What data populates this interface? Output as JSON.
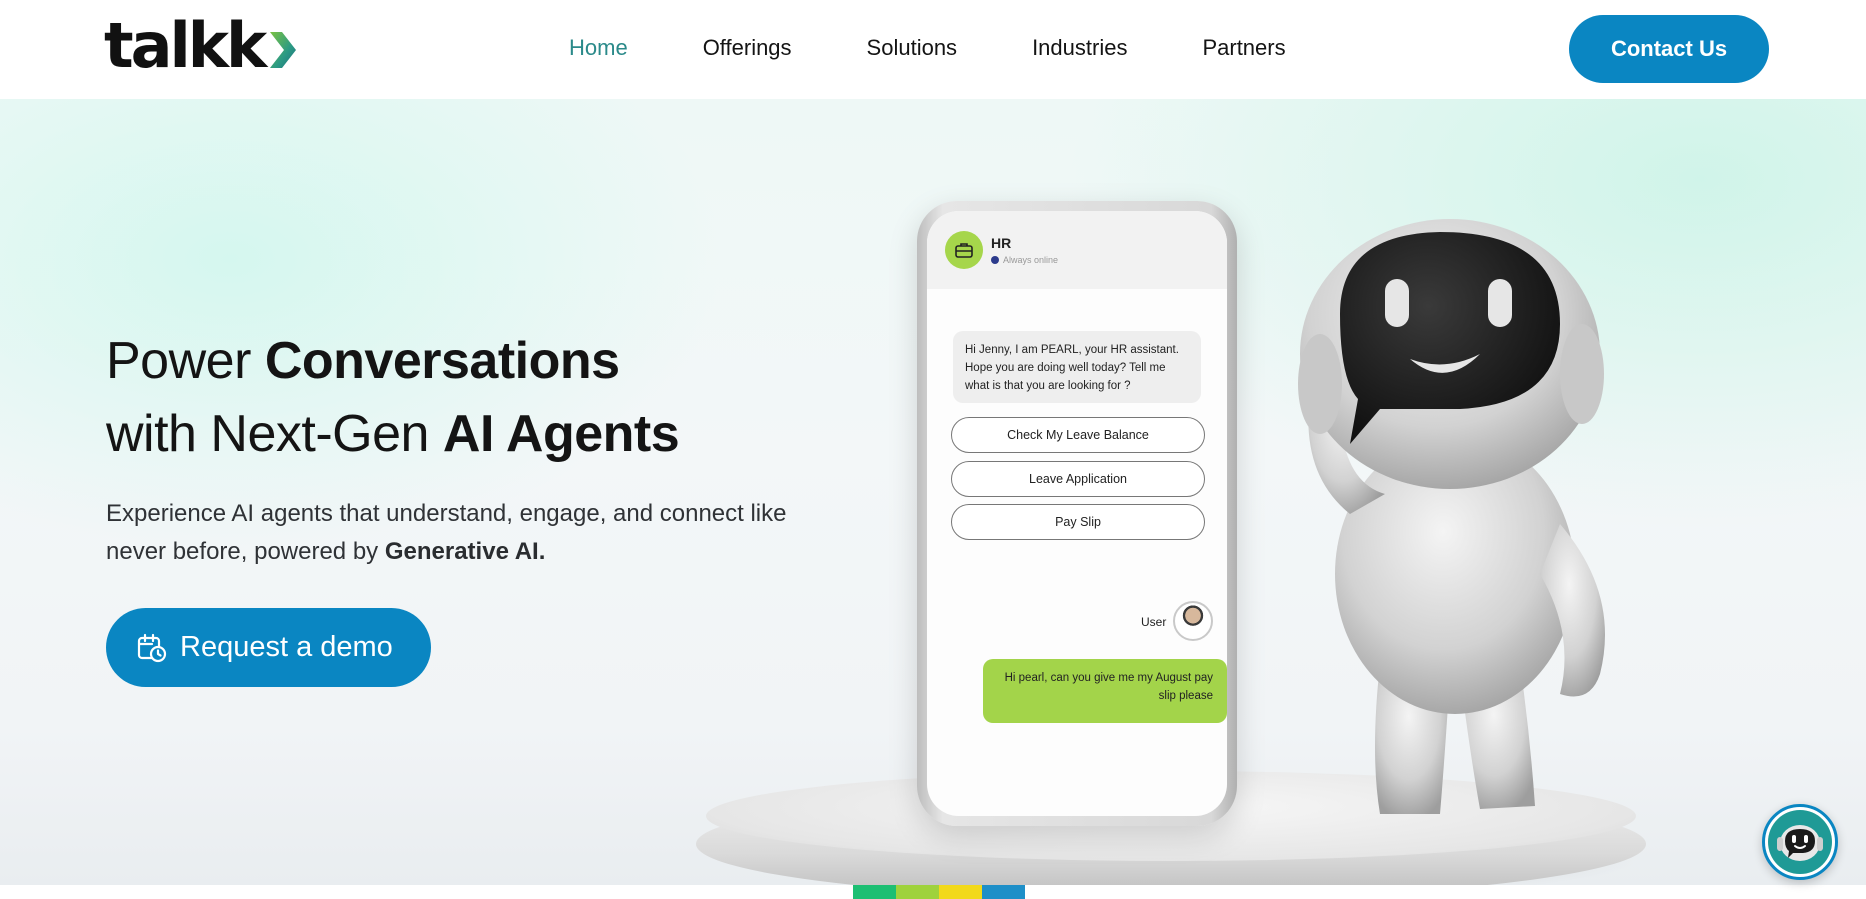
{
  "header": {
    "logo_text": "talkk",
    "logo_icon": "chevron-right-icon",
    "nav": [
      {
        "label": "Home",
        "active": true
      },
      {
        "label": "Offerings",
        "active": false
      },
      {
        "label": "Solutions",
        "active": false
      },
      {
        "label": "Industries",
        "active": false
      },
      {
        "label": "Partners",
        "active": false
      }
    ],
    "contact_label": "Contact Us"
  },
  "hero": {
    "headline_line1_light": "Power ",
    "headline_line1_bold": "Conversations",
    "headline_line2_light": "with Next-Gen ",
    "headline_line2_bold": "AI Agents",
    "subtext_plain": "Experience AI agents that understand, engage, and connect like never before, powered by ",
    "subtext_bold": "Generative AI.",
    "demo_label": "Request a demo",
    "demo_icon": "calendar-clock-icon"
  },
  "phone_chat": {
    "bot_name": "HR",
    "bot_status": "Always online",
    "bot_message": "Hi Jenny, I am PEARL, your HR assistant. Hope you are doing well today? Tell me what is that you are looking for ?",
    "options": [
      "Check My Leave Balance",
      "Leave Application",
      "Pay Slip"
    ],
    "user_label": "User",
    "user_message": "Hi pearl, can you give me my August pay slip please"
  },
  "colors": {
    "brand_blue": "#0a86c2",
    "nav_active": "#2b8a8a",
    "chat_green": "#a3d44a",
    "strip": [
      "#1dbf73",
      "#9fd23c",
      "#f2d91a",
      "#1e8fc8"
    ]
  },
  "chatbot_fab_icon": "robot-chat-icon"
}
